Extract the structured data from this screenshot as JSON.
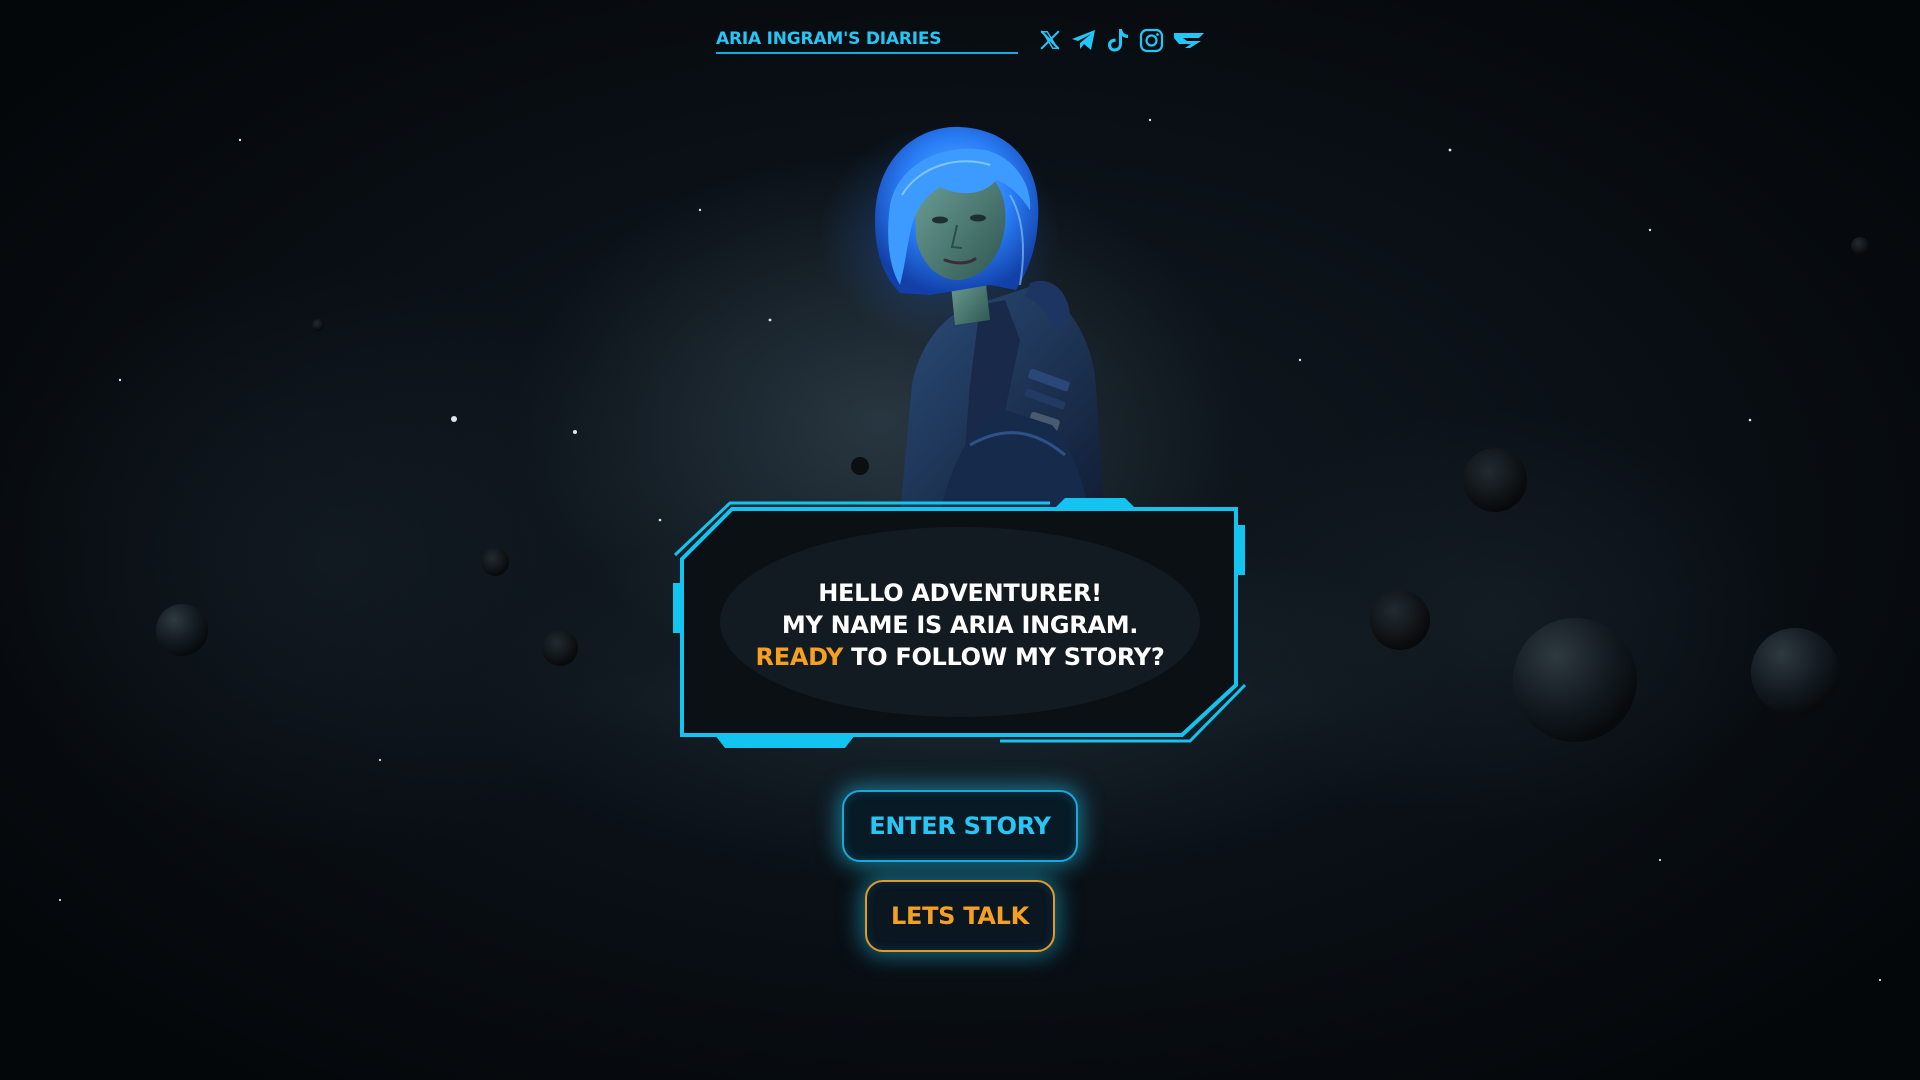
{
  "header": {
    "title": "ARIA INGRAM'S DIARIES",
    "socials": [
      "x-icon",
      "telegram-icon",
      "tiktok-icon",
      "instagram-icon",
      "partner-logo-icon"
    ]
  },
  "dialog": {
    "line1": "HELLO ADVENTURER!",
    "line2": "MY NAME IS ARIA INGRAM.",
    "line3_accent": "READY",
    "line3_rest": " TO FOLLOW MY STORY?"
  },
  "buttons": {
    "enter_story": "ENTER STORY",
    "lets_talk": "LETS TALK"
  },
  "colors": {
    "primary_cyan": "#23c6f7",
    "accent_orange": "#f7a020",
    "background": "#05080b"
  }
}
